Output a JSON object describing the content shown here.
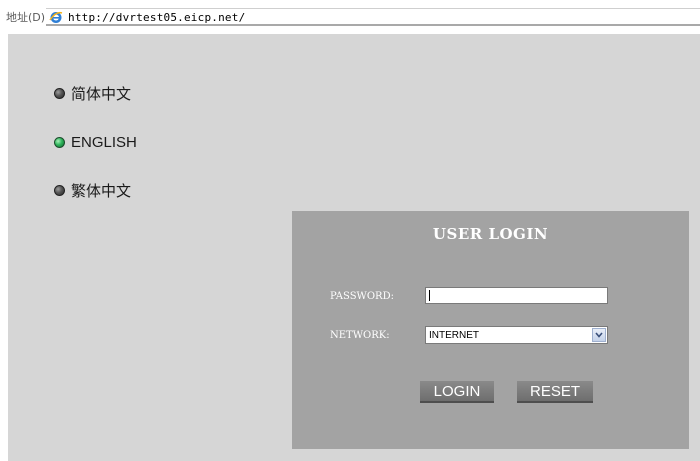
{
  "address_bar": {
    "label": "地址(D)",
    "url": "http://dvrtest05.eicp.net/",
    "icon": "ie-icon"
  },
  "languages": [
    {
      "label": "简体中文",
      "indicator": "dark"
    },
    {
      "label": "ENGLISH",
      "indicator": "green",
      "selected": true
    },
    {
      "label": "繁体中文",
      "indicator": "dark"
    }
  ],
  "login": {
    "title": "USER LOGIN",
    "password_label": "PASSWORD:",
    "password_value": "",
    "network_label": "NETWORK:",
    "network_value": "INTERNET",
    "login_button": "LOGIN",
    "reset_button": "RESET"
  },
  "colors": {
    "page_background": "#d6d6d6",
    "panel_background": "#a3a3a3",
    "button_background": "#7a7a7a",
    "active_indicator": "#2fb45c"
  }
}
